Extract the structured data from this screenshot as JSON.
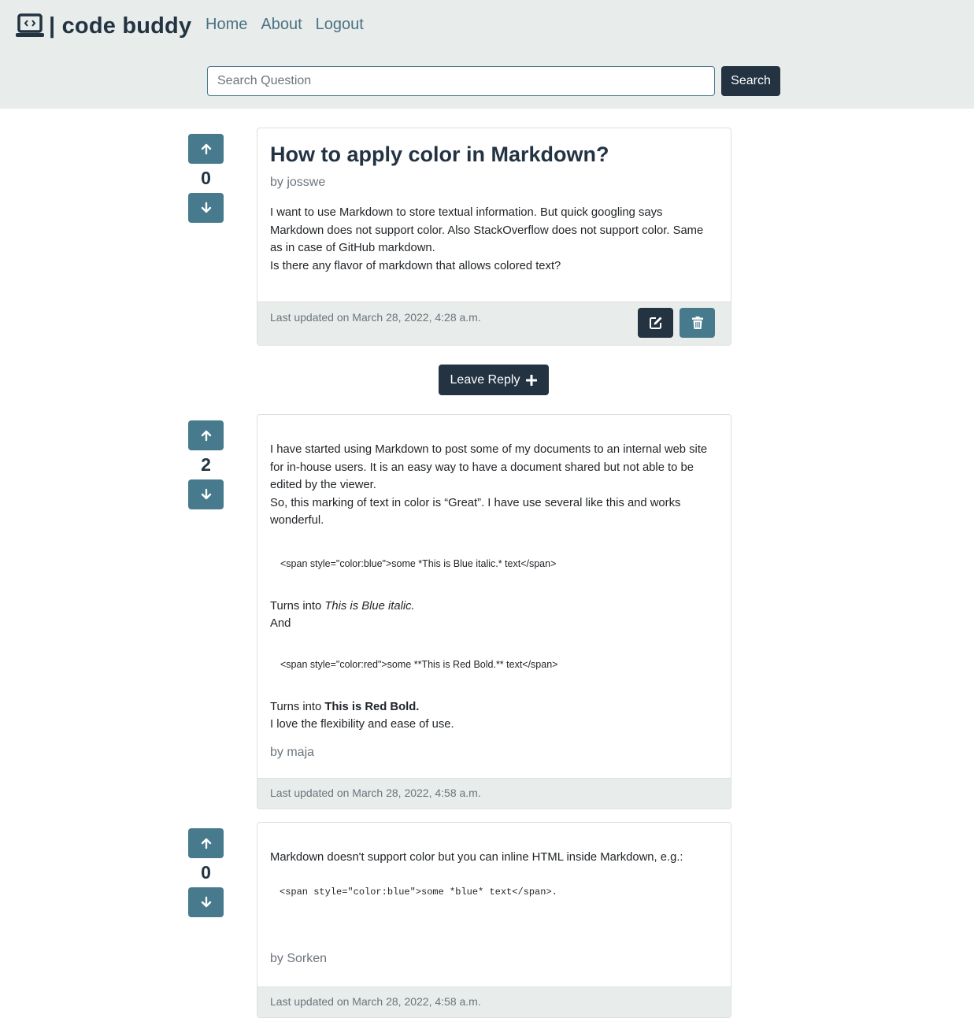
{
  "brand": {
    "name": "| code buddy",
    "icon": "laptop-code-icon"
  },
  "nav": [
    {
      "label": "Home"
    },
    {
      "label": "About"
    },
    {
      "label": "Logout"
    }
  ],
  "search": {
    "placeholder": "Search Question",
    "button_label": "Search"
  },
  "colors": {
    "dark": "#233342",
    "teal": "#477a8d",
    "header_bg": "#e8ecea",
    "nav_link": "#4a7284"
  },
  "question": {
    "votes": "0",
    "title": "How to apply color in Markdown?",
    "author": "by josswe",
    "body": [
      "I want to use Markdown to store textual information. But quick googling says",
      "Markdown does not support color. Also StackOverflow does not support color. Same",
      "as in case of GitHub markdown.",
      "Is there any flavor of markdown that allows colored text?"
    ],
    "updated": "Last updated on March 28, 2022, 4:28 a.m."
  },
  "reply_button_label": "Leave Reply",
  "answers": [
    {
      "votes": "2",
      "body_1": [
        "I have started using Markdown to post some of my documents to an internal web site",
        "for in-house users. It is an easy way to have a document shared but not able to be",
        "edited by the viewer.",
        "So, this marking of text in color is “Great”. I have use several like this and works",
        "wonderful."
      ],
      "code_1": "<span style=\"color:blue\">some *This is Blue italic.* text</span>",
      "turns_into_1": "Turns into ",
      "emph_1": "This is Blue italic.",
      "and": "And",
      "code_2": "<span style=\"color:red\">some **This is Red Bold.** text</span>",
      "turns_into_2": "Turns into ",
      "emph_2": "This is Red Bold.",
      "closing": "I love the flexibility and ease of use.",
      "author": "by maja",
      "updated": "Last updated on March 28, 2022, 4:58 a.m."
    },
    {
      "votes": "0",
      "body": "Markdown doesn't support color but you can inline HTML inside Markdown, e.g.:",
      "code": "<span style=\"color:blue\">some *blue* text</span>.",
      "author": "by Sorken",
      "updated": "Last updated on March 28, 2022, 4:58 a.m."
    }
  ]
}
